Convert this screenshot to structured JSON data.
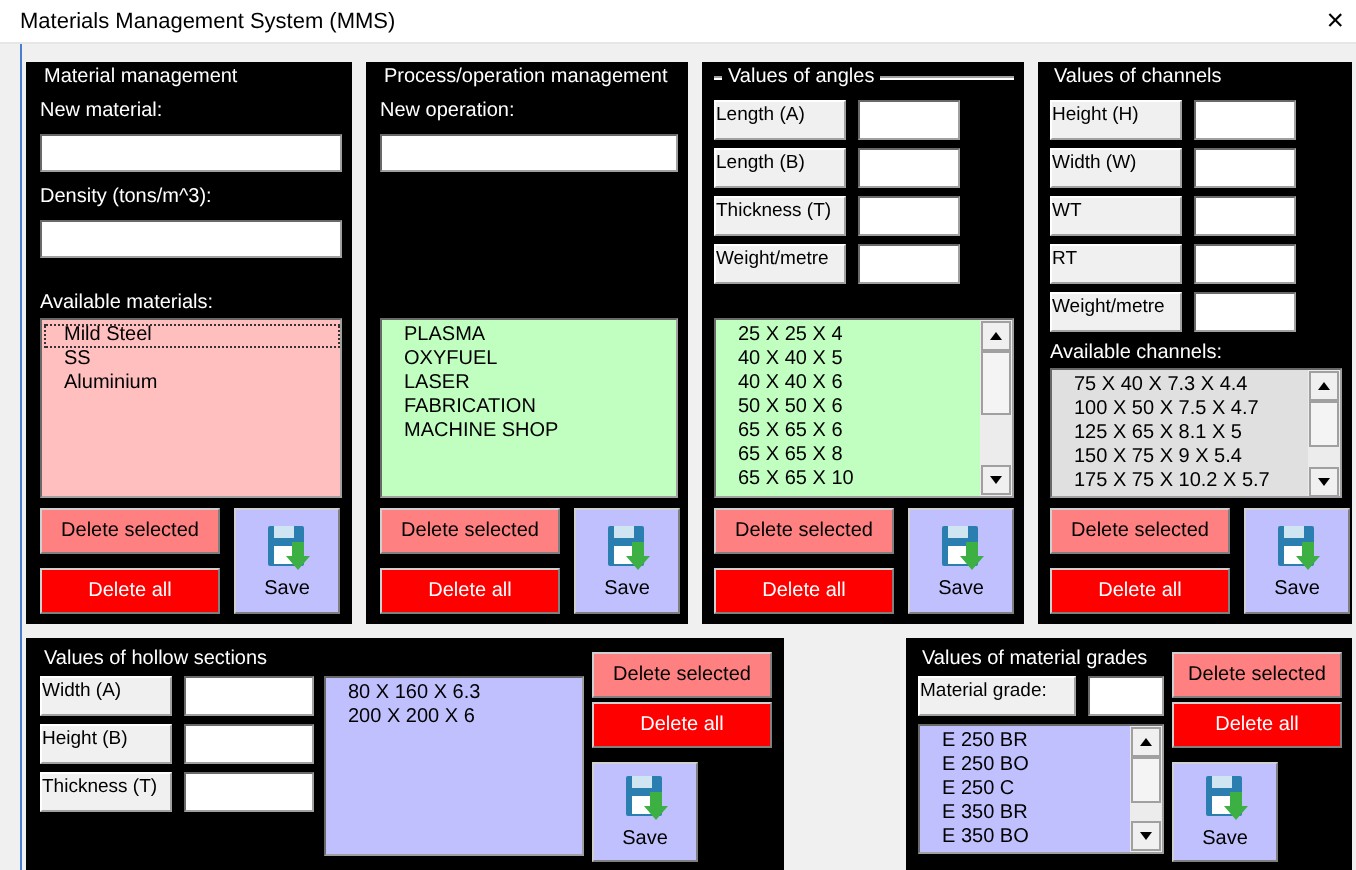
{
  "window": {
    "title": "Materials Management System (MMS)",
    "close": "×"
  },
  "material_management": {
    "title": "Material management",
    "fields": [
      {
        "label": "New material:"
      },
      {
        "label": "Density (tons/m^3):"
      }
    ],
    "list_label": "Available materials:",
    "items": [
      {
        "text": "Mild Steel",
        "selected": true
      },
      {
        "text": "SS",
        "selected": false
      },
      {
        "text": "Aluminium",
        "selected": false
      }
    ],
    "buttons": [
      {
        "kind": "delete_selected",
        "label": "Delete selected"
      },
      {
        "kind": "delete_all",
        "label": "Delete all"
      },
      {
        "kind": "save",
        "label": "Save"
      }
    ]
  },
  "operation_management": {
    "title": "Process/operation management",
    "fields": [
      {
        "label": "New operation:"
      }
    ],
    "items": [
      {
        "text": "PLASMA",
        "selected": false
      },
      {
        "text": "OXYFUEL",
        "selected": false
      },
      {
        "text": "LASER",
        "selected": false
      },
      {
        "text": "FABRICATION",
        "selected": false
      },
      {
        "text": "MACHINE SHOP",
        "selected": false
      }
    ],
    "buttons": [
      {
        "kind": "delete_selected",
        "label": "Delete selected"
      },
      {
        "kind": "delete_all",
        "label": "Delete all"
      },
      {
        "kind": "save",
        "label": "Save"
      }
    ]
  },
  "angles": {
    "title": "Values of angles",
    "fields": [
      {
        "label": "Length (A)"
      },
      {
        "label": "Length (B)"
      },
      {
        "label": "Thickness (T)"
      },
      {
        "label": "Weight/metre"
      }
    ],
    "items": [
      {
        "text": "25 X 25 X 4",
        "selected": false
      },
      {
        "text": "40 X 40 X 5",
        "selected": false
      },
      {
        "text": "40 X 40 X 6",
        "selected": false
      },
      {
        "text": "50 X 50 X 6",
        "selected": false
      },
      {
        "text": "65 X 65 X 6",
        "selected": false
      },
      {
        "text": "65 X 65 X 8",
        "selected": false
      },
      {
        "text": "65 X 65 X 10",
        "selected": false
      }
    ],
    "buttons": [
      {
        "kind": "delete_selected",
        "label": "Delete selected"
      },
      {
        "kind": "delete_all",
        "label": "Delete all"
      },
      {
        "kind": "save",
        "label": "Save"
      }
    ]
  },
  "channels": {
    "title": "Values of channels",
    "fields": [
      {
        "label": "Height (H)"
      },
      {
        "label": "Width (W)"
      },
      {
        "label": "WT"
      },
      {
        "label": "RT"
      },
      {
        "label": "Weight/metre"
      }
    ],
    "list_label": "Available channels:",
    "items": [
      {
        "text": "75 X 40 X 7.3 X 4.4",
        "selected": false
      },
      {
        "text": "100 X 50 X 7.5 X 4.7",
        "selected": false
      },
      {
        "text": "125 X 65 X 8.1 X 5",
        "selected": false
      },
      {
        "text": "150 X 75 X 9 X 5.4",
        "selected": false
      },
      {
        "text": "175 X 75 X 10.2 X 5.7",
        "selected": false
      }
    ],
    "buttons": [
      {
        "kind": "delete_selected",
        "label": "Delete selected"
      },
      {
        "kind": "delete_all",
        "label": "Delete all"
      },
      {
        "kind": "save",
        "label": "Save"
      }
    ]
  },
  "hollow_sections": {
    "title": "Values of hollow sections",
    "fields": [
      {
        "label": "Width (A)"
      },
      {
        "label": "Height (B)"
      },
      {
        "label": "Thickness (T)"
      }
    ],
    "items": [
      {
        "text": "80 X 160 X 6.3",
        "selected": false
      },
      {
        "text": "200 X 200 X 6",
        "selected": false
      }
    ],
    "buttons": [
      {
        "kind": "delete_selected",
        "label": "Delete selected"
      },
      {
        "kind": "delete_all",
        "label": "Delete all"
      },
      {
        "kind": "save",
        "label": "Save"
      }
    ]
  },
  "material_grades": {
    "title": "Values of material grades",
    "fields": [
      {
        "label": "Material grade:"
      }
    ],
    "items": [
      {
        "text": "E 250 BR",
        "selected": false
      },
      {
        "text": "E 250 BO",
        "selected": false
      },
      {
        "text": "E 250 C",
        "selected": false
      },
      {
        "text": "E 350 BR",
        "selected": false
      },
      {
        "text": "E 350 BO",
        "selected": false
      }
    ],
    "buttons": [
      {
        "kind": "delete_selected",
        "label": "Delete selected"
      },
      {
        "kind": "delete_all",
        "label": "Delete all"
      },
      {
        "kind": "save",
        "label": "Save"
      }
    ]
  }
}
